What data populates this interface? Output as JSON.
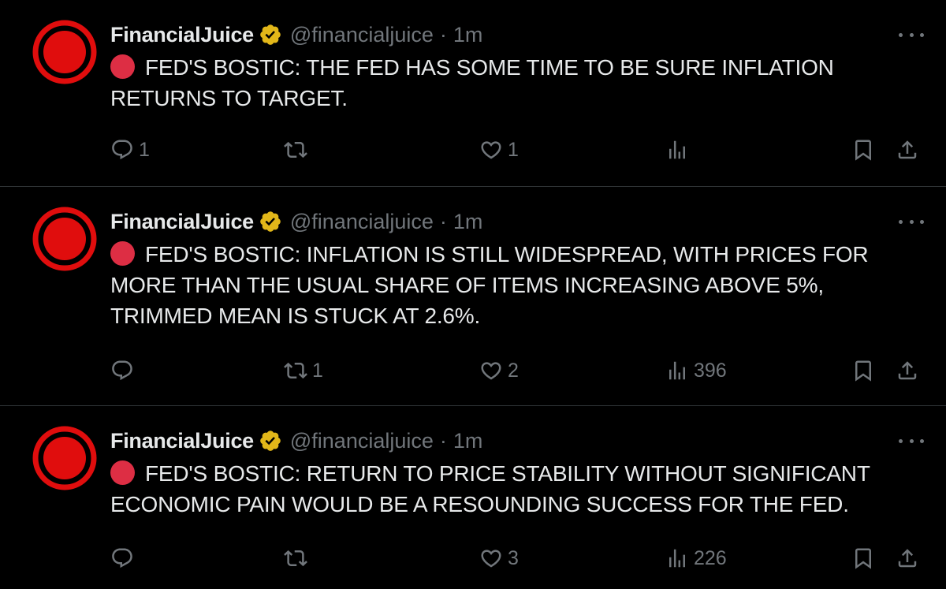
{
  "colors": {
    "background": "#000000",
    "text": "#e7e9ea",
    "muted": "#71767b",
    "divider": "#2f3336",
    "avatar_red": "#e00d0d",
    "red_circle_emoji": "#dd2e44",
    "verified_gold": "#e2b719"
  },
  "tweets": [
    {
      "author": {
        "name": "FinancialJuice",
        "handle": "@financialjuice",
        "verified_icon": "gold-verified-badge-icon"
      },
      "separator": "·",
      "time": "1m",
      "text": "FED'S BOSTIC: THE FED HAS SOME TIME TO BE SURE INFLATION RETURNS TO TARGET.",
      "actions": {
        "replies": "1",
        "retweets": "",
        "likes": "1",
        "views": ""
      }
    },
    {
      "author": {
        "name": "FinancialJuice",
        "handle": "@financialjuice",
        "verified_icon": "gold-verified-badge-icon"
      },
      "separator": "·",
      "time": "1m",
      "text": "FED'S BOSTIC: INFLATION IS STILL WIDESPREAD, WITH PRICES FOR MORE THAN THE USUAL SHARE OF ITEMS INCREASING ABOVE 5%, TRIMMED MEAN IS STUCK AT 2.6%.",
      "actions": {
        "replies": "",
        "retweets": "1",
        "likes": "2",
        "views": "396"
      }
    },
    {
      "author": {
        "name": "FinancialJuice",
        "handle": "@financialjuice",
        "verified_icon": "gold-verified-badge-icon"
      },
      "separator": "·",
      "time": "1m",
      "text": "FED'S BOSTIC: RETURN TO PRICE STABILITY WITHOUT SIGNIFICANT ECONOMIC PAIN WOULD BE A RESOUNDING SUCCESS FOR THE FED.",
      "actions": {
        "replies": "",
        "retweets": "",
        "likes": "3",
        "views": "226"
      }
    }
  ]
}
